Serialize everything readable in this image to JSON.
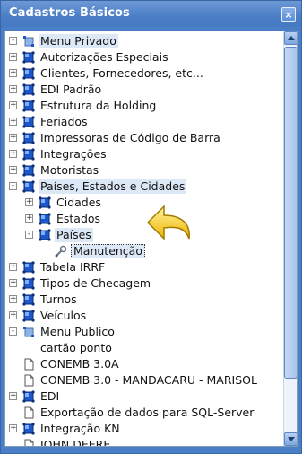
{
  "window": {
    "title": "Cadastros Básicos",
    "close_glyph": "×"
  },
  "colors": {
    "titlebar": "#4a7fc6",
    "selection": "#dde8f7",
    "folder_icon": "#1d56c8",
    "pointer": "#f4c21a"
  },
  "tree": {
    "items": [
      {
        "label": "Menu Privado",
        "icon": "node-menu-icon",
        "expander": "-",
        "selected": true
      },
      {
        "label": "Autorizações Especiais",
        "icon": "folder-icon",
        "expander": "+"
      },
      {
        "label": "Clientes, Fornecedores, etc...",
        "icon": "folder-icon",
        "expander": "+"
      },
      {
        "label": "EDI Padrão",
        "icon": "folder-icon",
        "expander": "+"
      },
      {
        "label": "Estrutura da Holding",
        "icon": "folder-icon",
        "expander": "+"
      },
      {
        "label": "Feriados",
        "icon": "folder-icon",
        "expander": "+"
      },
      {
        "label": "Impressoras de Código de Barra",
        "icon": "folder-icon",
        "expander": "+"
      },
      {
        "label": "Integrações",
        "icon": "folder-icon",
        "expander": "+"
      },
      {
        "label": "Motoristas",
        "icon": "folder-icon",
        "expander": "+"
      },
      {
        "label": "Países, Estados e Cidades",
        "icon": "folder-icon",
        "expander": "-",
        "selected": true
      },
      {
        "label": "Cidades",
        "icon": "folder-icon",
        "expander": "+"
      },
      {
        "label": "Estados",
        "icon": "folder-icon",
        "expander": "+"
      },
      {
        "label": "Países",
        "icon": "folder-icon",
        "expander": "-",
        "selected": true
      },
      {
        "label": "Manutenção",
        "icon": "wrench-icon",
        "expander": "",
        "focused": true
      },
      {
        "label": "Tabela IRRF",
        "icon": "folder-icon",
        "expander": "+"
      },
      {
        "label": "Tipos de Checagem",
        "icon": "folder-icon",
        "expander": "+"
      },
      {
        "label": "Turnos",
        "icon": "folder-icon",
        "expander": "+"
      },
      {
        "label": "Veículos",
        "icon": "folder-icon",
        "expander": "+"
      },
      {
        "label": "Menu Publico",
        "icon": "node-menu-icon",
        "expander": "-"
      },
      {
        "label": "cartão ponto",
        "icon": "",
        "expander": ""
      },
      {
        "label": "CONEMB 3.0A",
        "icon": "document-icon",
        "expander": ""
      },
      {
        "label": "CONEMB 3.0 - MANDACARU - MARISOL",
        "icon": "document-icon",
        "expander": ""
      },
      {
        "label": "EDI",
        "icon": "folder-icon",
        "expander": "+"
      },
      {
        "label": "Exportação de dados para SQL-Server",
        "icon": "document-icon",
        "expander": ""
      },
      {
        "label": "Integração KN",
        "icon": "folder-icon",
        "expander": "+"
      },
      {
        "label": "JOHN DEERE",
        "icon": "document-icon",
        "expander": ""
      }
    ]
  }
}
